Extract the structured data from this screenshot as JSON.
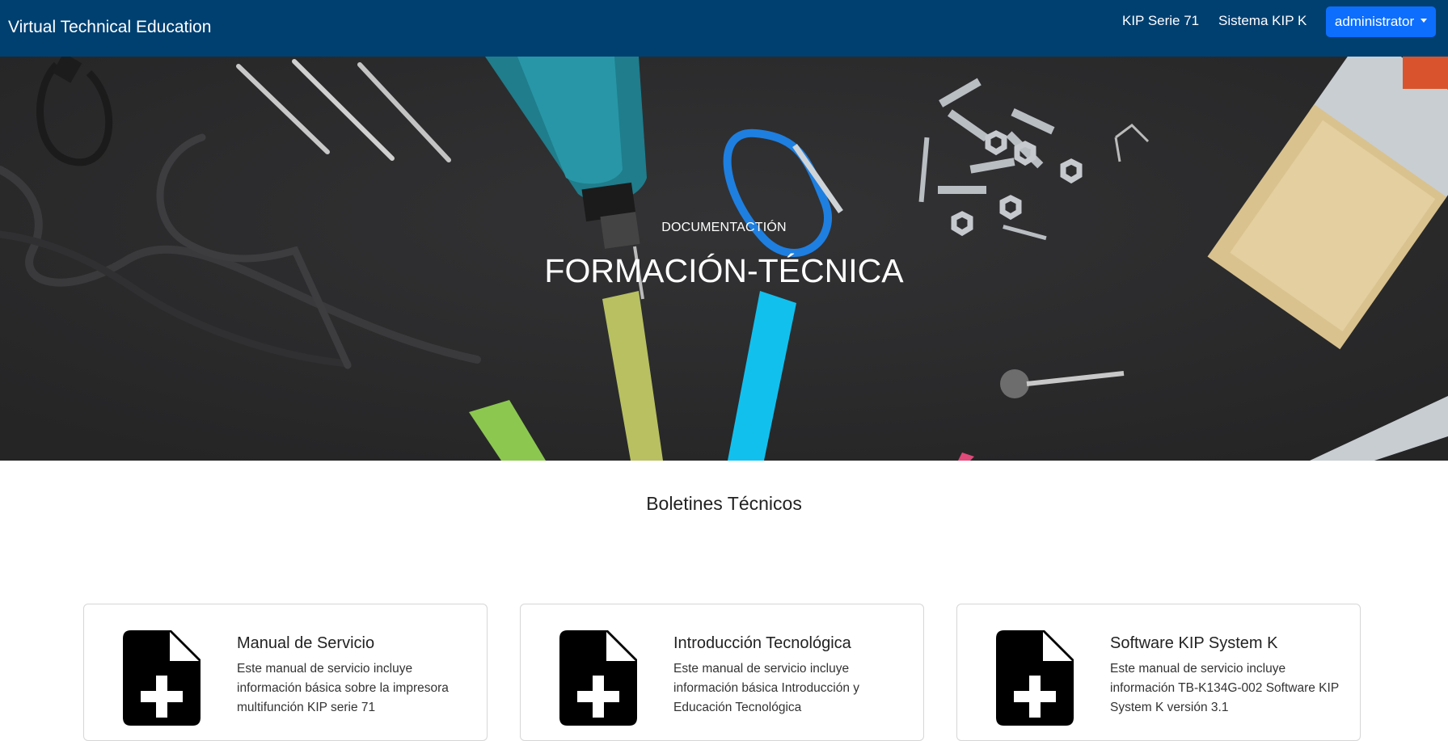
{
  "navbar": {
    "brand": "Virtual Technical Education",
    "links": [
      {
        "label": "KIP Serie 71"
      },
      {
        "label": "Sistema KIP K"
      }
    ],
    "user_menu": {
      "label": "administrator"
    },
    "background_color": "#004071",
    "button_color": "#0d6efd"
  },
  "hero": {
    "subtitle": "DOCUMENTACTIÓN",
    "title": "FORMACIÓN-TÉCNICA",
    "background_color": "#2a2a2b"
  },
  "section": {
    "title": "Boletines Técnicos"
  },
  "cards": [
    {
      "icon": "file-plus-icon",
      "title": "Manual de Servicio",
      "text": "Este manual de servicio incluye información básica sobre la impresora multifunción KIP serie 71"
    },
    {
      "icon": "file-plus-icon",
      "title": "Introducción Tecnológica",
      "text": "Este manual de servicio incluye información básica Introducción y Educación Tecnológica"
    },
    {
      "icon": "file-plus-icon",
      "title": "Software KIP System K",
      "text": "Este manual de servicio incluye información TB-K134G-002 Software KIP System K versión 3.1"
    }
  ]
}
